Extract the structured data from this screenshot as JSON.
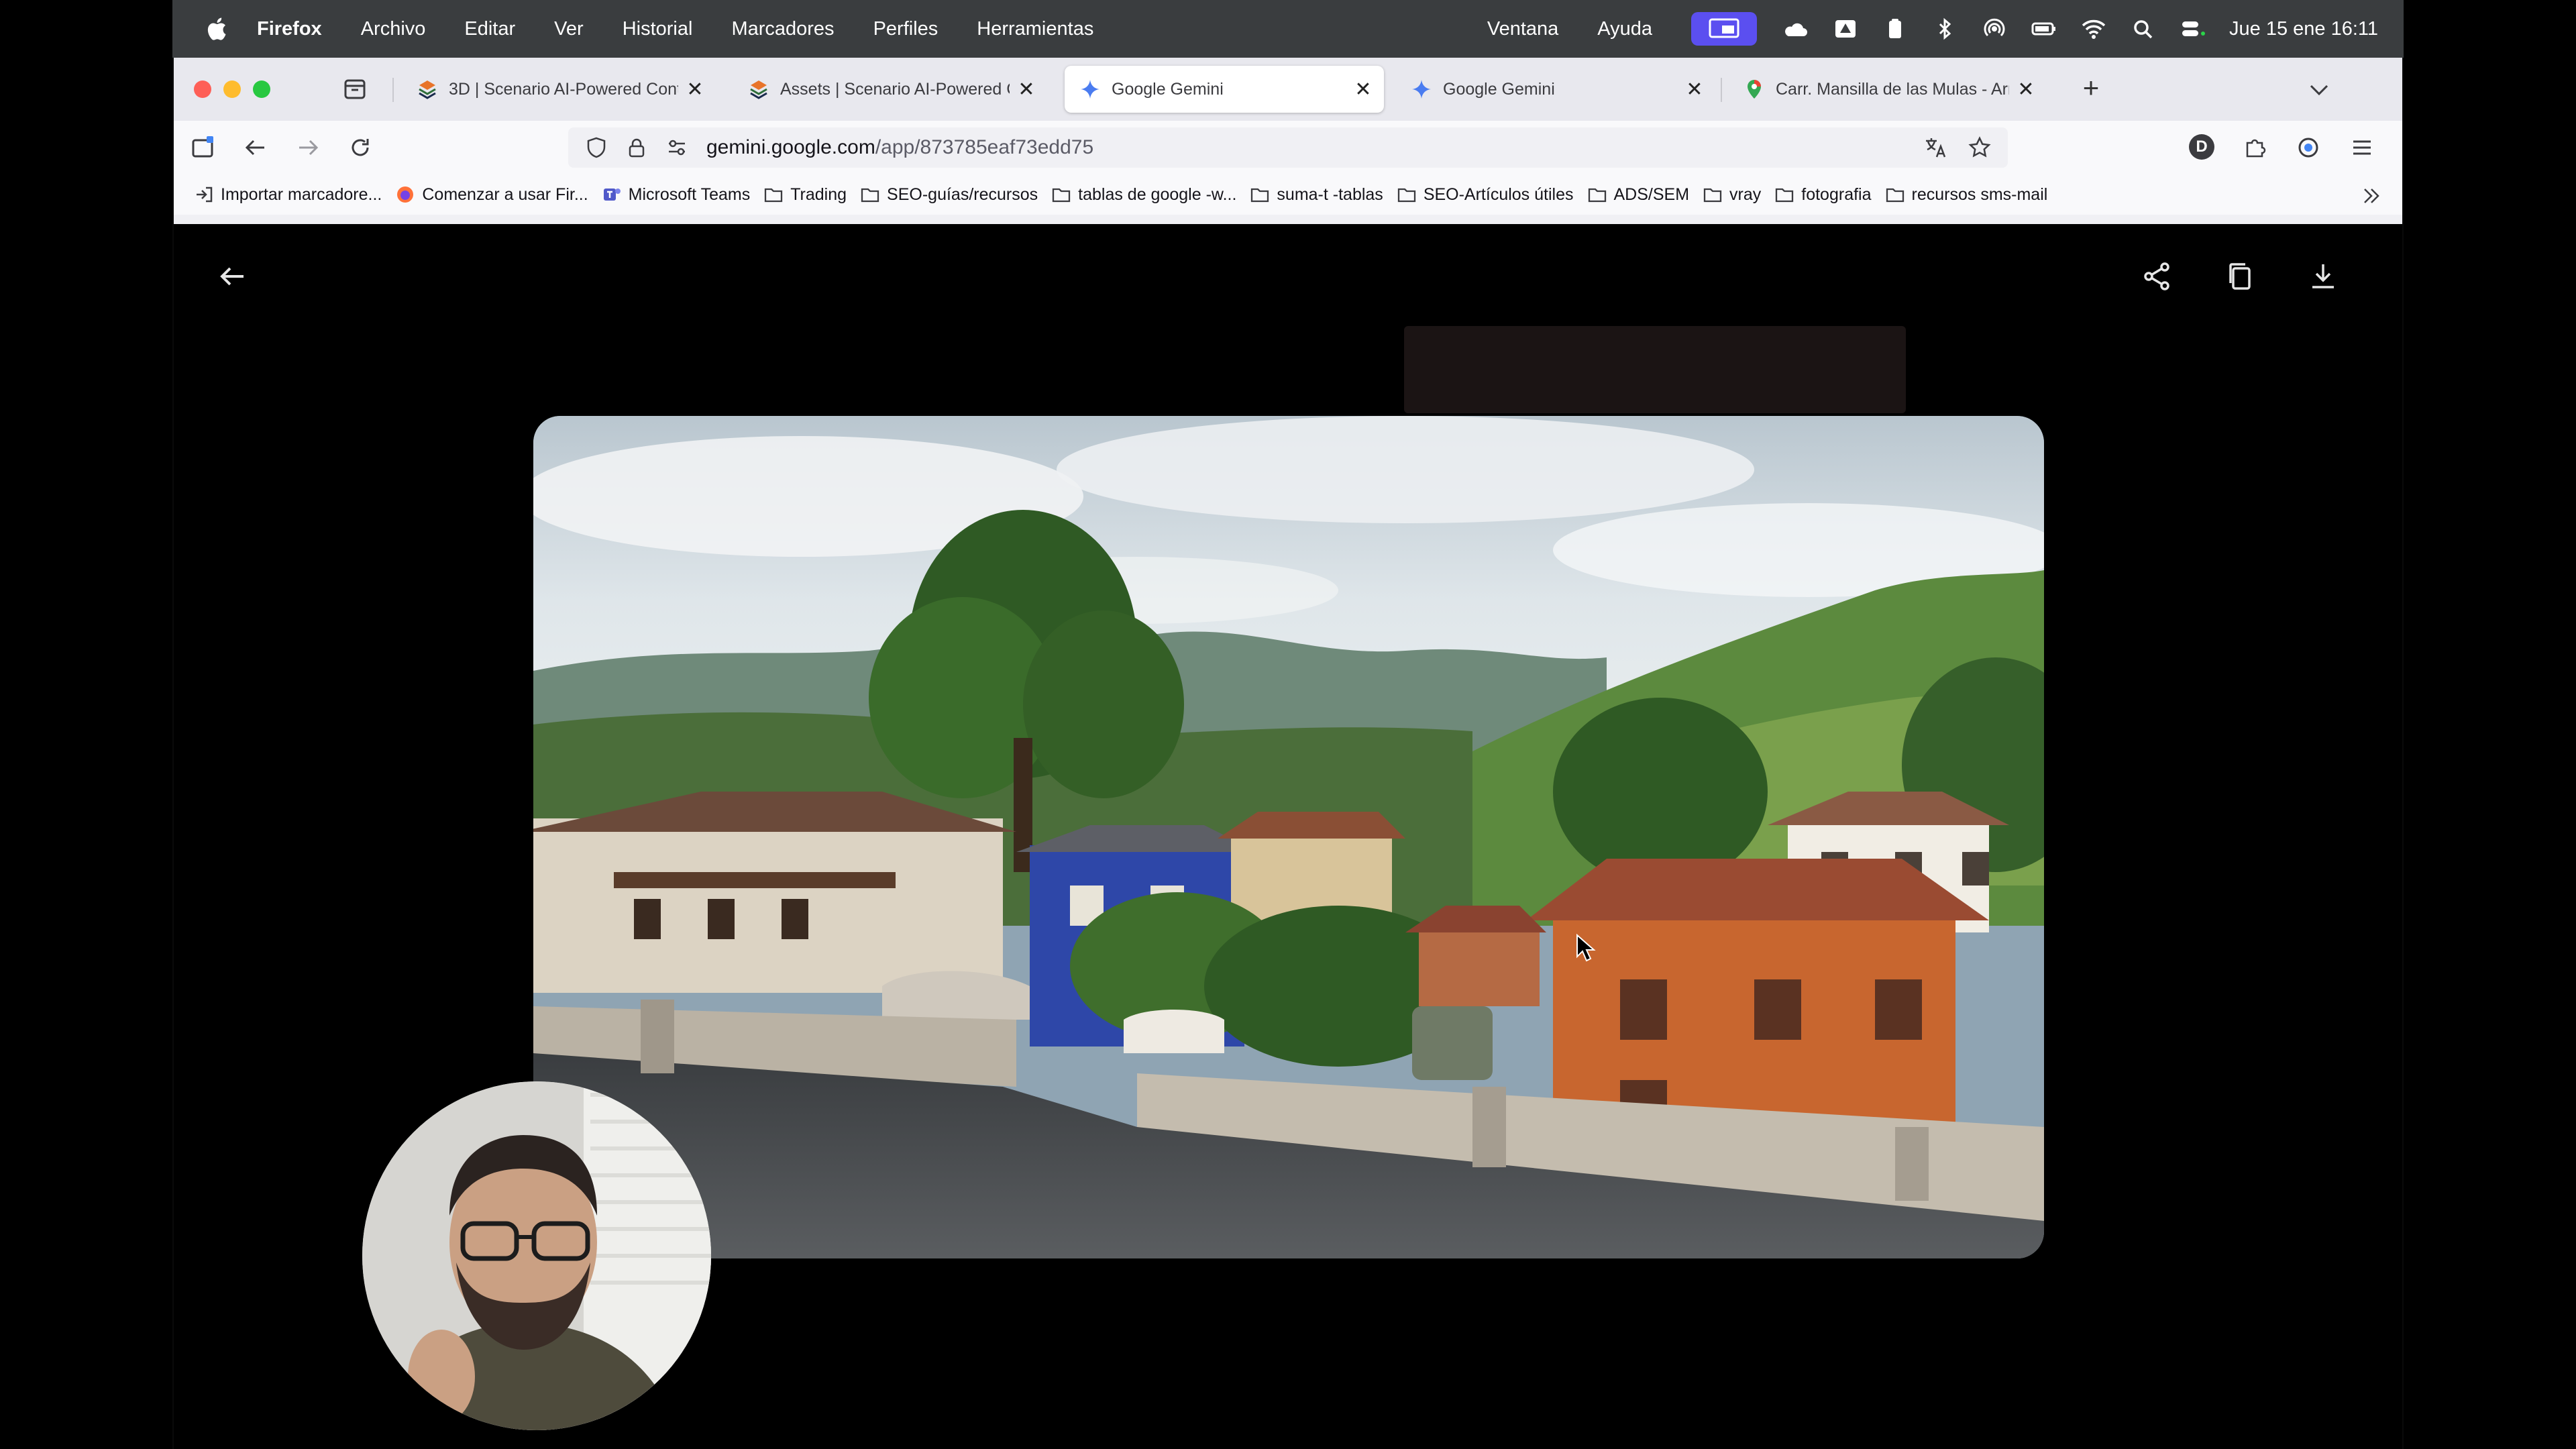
{
  "menubar": {
    "items": [
      "Firefox",
      "Archivo",
      "Editar",
      "Ver",
      "Historial",
      "Marcadores",
      "Perfiles",
      "Herramientas"
    ],
    "right_items": [
      "Ventana",
      "Ayuda"
    ],
    "clock": "Jue 15 ene 16:11",
    "screen_share_color": "#5b4ff0"
  },
  "tabs": [
    {
      "title": "3D | Scenario AI-Powered Content",
      "icon": "scenario-icon",
      "active": false
    },
    {
      "title": "Assets | Scenario AI-Powered Content",
      "icon": "scenario-icon",
      "active": false
    },
    {
      "title": "Google Gemini",
      "icon": "gemini-icon",
      "active": true
    },
    {
      "title": "Google Gemini",
      "icon": "gemini-icon",
      "active": false
    },
    {
      "title": "Carr. Mansilla de las Mulas - Arr",
      "icon": "maps-pin-icon",
      "active": false
    }
  ],
  "address_bar": {
    "domain": "gemini.google.com",
    "path": "/app/873785eaf73edd75"
  },
  "profile_initial": "D",
  "bookmarks": [
    {
      "label": "Importar marcadore...",
      "icon": "import-icon"
    },
    {
      "label": "Comenzar a usar Fir...",
      "icon": "firefox-icon"
    },
    {
      "label": "Microsoft Teams",
      "icon": "teams-icon"
    },
    {
      "label": "Trading",
      "icon": "folder-icon"
    },
    {
      "label": "SEO-guías/recursos",
      "icon": "folder-icon"
    },
    {
      "label": "tablas de google -w...",
      "icon": "folder-icon"
    },
    {
      "label": "suma-t -tablas",
      "icon": "folder-icon"
    },
    {
      "label": "SEO-Artículos útiles",
      "icon": "folder-icon"
    },
    {
      "label": "ADS/SEM",
      "icon": "folder-icon"
    },
    {
      "label": "vray",
      "icon": "folder-icon"
    },
    {
      "label": "fotografia",
      "icon": "folder-icon"
    },
    {
      "label": "recursos sms-mail",
      "icon": "folder-icon"
    }
  ],
  "viewer": {
    "actions": [
      "share-icon",
      "copy-icon",
      "download-icon"
    ]
  },
  "colors": {
    "accent_red": "#e0231f",
    "house_blue": "#2e47a8",
    "house_orange": "#c8662f"
  }
}
